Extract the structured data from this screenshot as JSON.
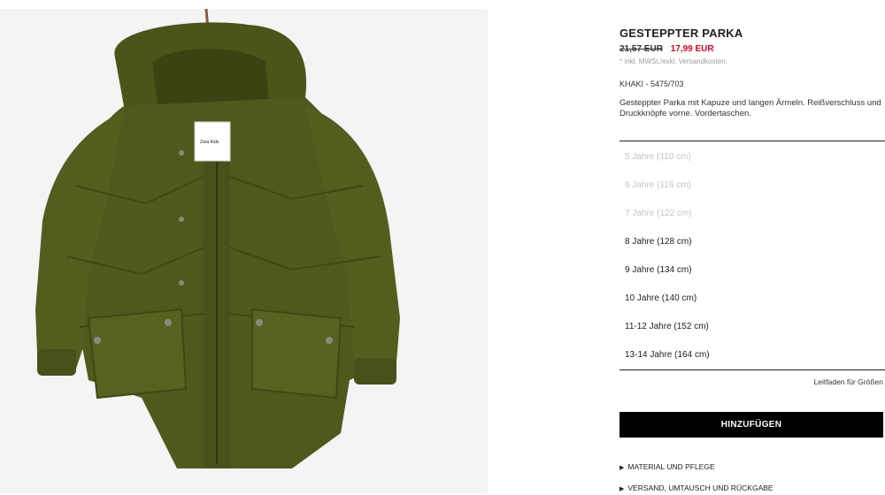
{
  "product": {
    "title": "GESTEPPTER PARKA",
    "price_old": "21,57 EUR",
    "price_new": "17,99 EUR",
    "tax_note": "* inkl. MWSt./exkl. Versandkosten.",
    "color_ref": "KHAKI - 5475/703",
    "description": "Gesteppter Parka mit Kapuze und langen Ärmeln. Reißverschluss und Druckknöpfe vorne. Vordertaschen.",
    "image_label": "Zara Kids"
  },
  "sizes": [
    {
      "label": "5 Jahre (110 cm)",
      "available": false
    },
    {
      "label": "6 Jahre (116 cm)",
      "available": false
    },
    {
      "label": "7 Jahre (122 cm)",
      "available": false
    },
    {
      "label": "8 Jahre (128 cm)",
      "available": true
    },
    {
      "label": "9 Jahre (134 cm)",
      "available": true
    },
    {
      "label": "10 Jahre (140 cm)",
      "available": true
    },
    {
      "label": "11-12 Jahre (152 cm)",
      "available": true
    },
    {
      "label": "13-14 Jahre (164 cm)",
      "available": true
    }
  ],
  "size_guide_label": "Leitfaden für Größen",
  "add_button_label": "HINZUFÜGEN",
  "accordions": [
    {
      "label": "MATERIAL UND PFLEGE",
      "icon": "triangle-right-icon"
    },
    {
      "label": "VERSAND, UMTAUSCH UND RÜCKGABE",
      "icon": "triangle-right-icon"
    }
  ],
  "colors": {
    "accent_red": "#e3001b",
    "coat_khaki": "#4e5a1c",
    "button_black": "#000000",
    "unavailable_grey": "#c4c4c4"
  }
}
